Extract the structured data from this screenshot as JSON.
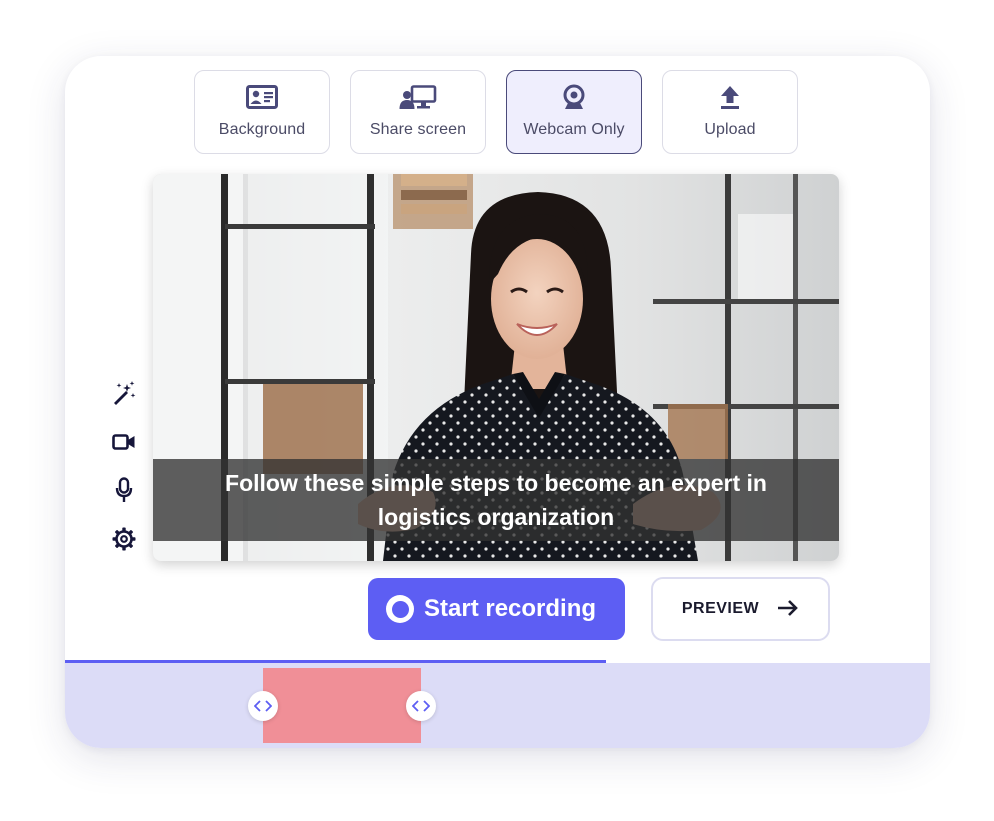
{
  "modes": [
    {
      "label": "Background",
      "icon": "id-card-icon",
      "active": false
    },
    {
      "label": "Share screen",
      "icon": "share-screen-icon",
      "active": false
    },
    {
      "label": "Webcam Only",
      "icon": "webcam-icon",
      "active": true
    },
    {
      "label": "Upload",
      "icon": "upload-icon",
      "active": false
    }
  ],
  "video": {
    "caption": "Follow these simple steps to become an expert in logistics organization"
  },
  "side_tools": [
    {
      "name": "magic-wand-icon"
    },
    {
      "name": "video-camera-icon"
    },
    {
      "name": "microphone-icon"
    },
    {
      "name": "gear-icon"
    }
  ],
  "actions": {
    "start_label": "Start recording",
    "preview_label": "PREVIEW"
  },
  "timeline": {
    "progress_fraction": 0.626
  },
  "colors": {
    "accent": "#5d5ef3",
    "timeline_bg": "#dcdcf7",
    "segment": "#f08f97",
    "icon": "#4a4a7a"
  }
}
